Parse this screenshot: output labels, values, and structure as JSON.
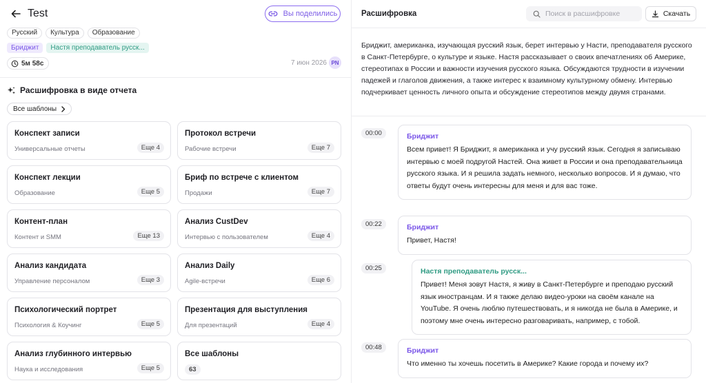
{
  "header": {
    "title": "Test",
    "shared_label": "Вы поделились",
    "tags": [
      "Русский",
      "Культура",
      "Образование"
    ],
    "speakers": [
      {
        "name": "Бриджит",
        "color": "purple"
      },
      {
        "name": "Настя преподаватель русск...",
        "color": "teal"
      }
    ],
    "duration": "5м 58с",
    "date": "7 июн 2026",
    "avatar_initials": "PN"
  },
  "report": {
    "section_title": "Расшифровка в виде отчета",
    "all_templates_button": "Все шаблоны",
    "cards": [
      {
        "title": "Конспект записи",
        "subtitle": "Универсальные отчеты",
        "more": "Еще 4"
      },
      {
        "title": "Протокол встречи",
        "subtitle": "Рабочие встречи",
        "more": "Еще 7"
      },
      {
        "title": "Конспект лекции",
        "subtitle": "Образование",
        "more": "Еще 5"
      },
      {
        "title": "Бриф по встрече с клиентом",
        "subtitle": "Продажи",
        "more": "Еще 7"
      },
      {
        "title": "Контент-план",
        "subtitle": "Контент и SMM",
        "more": "Еще 13"
      },
      {
        "title": "Анализ CustDev",
        "subtitle": "Интервью с пользователем",
        "more": "Еще 4"
      },
      {
        "title": "Анализ кандидата",
        "subtitle": "Управление персоналом",
        "more": "Еще 3"
      },
      {
        "title": "Анализ Daily",
        "subtitle": "Agile-встречи",
        "more": "Еще 6"
      },
      {
        "title": "Психологический портрет",
        "subtitle": "Психология & Коучинг",
        "more": "Еще 5"
      },
      {
        "title": "Презентация для выступления",
        "subtitle": "Для презентаций",
        "more": "Еще 4"
      },
      {
        "title": "Анализ глубинного интервью",
        "subtitle": "Наука и исследования",
        "more": "Еще 5"
      }
    ],
    "all_templates_card": {
      "title": "Все шаблоны",
      "count": "63"
    }
  },
  "transcript": {
    "title": "Расшифровка",
    "search_placeholder": "Поиск в расшифровке",
    "download_label": "Скачать",
    "summary": "Бриджит, американка, изучающая русский язык, берет интервью у Насти, преподавателя русского в Санкт-Петербурге, о культуре и языке. Настя рассказывает о своих впечатлениях об Америке, стереотипах в России и важности изучения русского языка. Обсуждаются трудности в изучении падежей и глаголов движения, а также интерес к взаимному культурному обмену. Интервью подчеркивает ценность личного опыта и обсуждение стереотипов между двумя странами.",
    "segments": [
      {
        "time": "00:00",
        "speaker": "Бриджит",
        "color": "purple",
        "text": "Всем привет! Я Бриджит, я американка и учу русский язык. Сегодня я записываю интервью с моей подругой Настей. Она живет в России и она преподавательница русского языка. И я решила задать немного, несколько вопросов. И я думаю, что ответы будут очень интересны для меня и для вас тоже."
      },
      {
        "time": "00:22",
        "speaker": "Бриджит",
        "color": "purple",
        "text": "Привет, Настя!"
      },
      {
        "time": "00:25",
        "speaker": "Настя преподаватель русск...",
        "color": "teal",
        "text": "Привет! Меня зовут Настя, я живу в Санкт-Петербурге и преподаю русский язык иностранцам. И я также делаю видео-уроки на своём канале на YouTube. Я очень люблю путешествовать, и я никогда не была в Америке, и поэтому мне очень интересно разговаривать, например, с тобой."
      },
      {
        "time": "00:48",
        "speaker": "Бриджит",
        "color": "purple",
        "text": "Что именно ты хочешь посетить в Америке? Какие города и почему их?"
      }
    ]
  },
  "colors": {
    "accent": "#7b57e8",
    "teal": "#2f9b83",
    "border": "#e3e3e8"
  }
}
